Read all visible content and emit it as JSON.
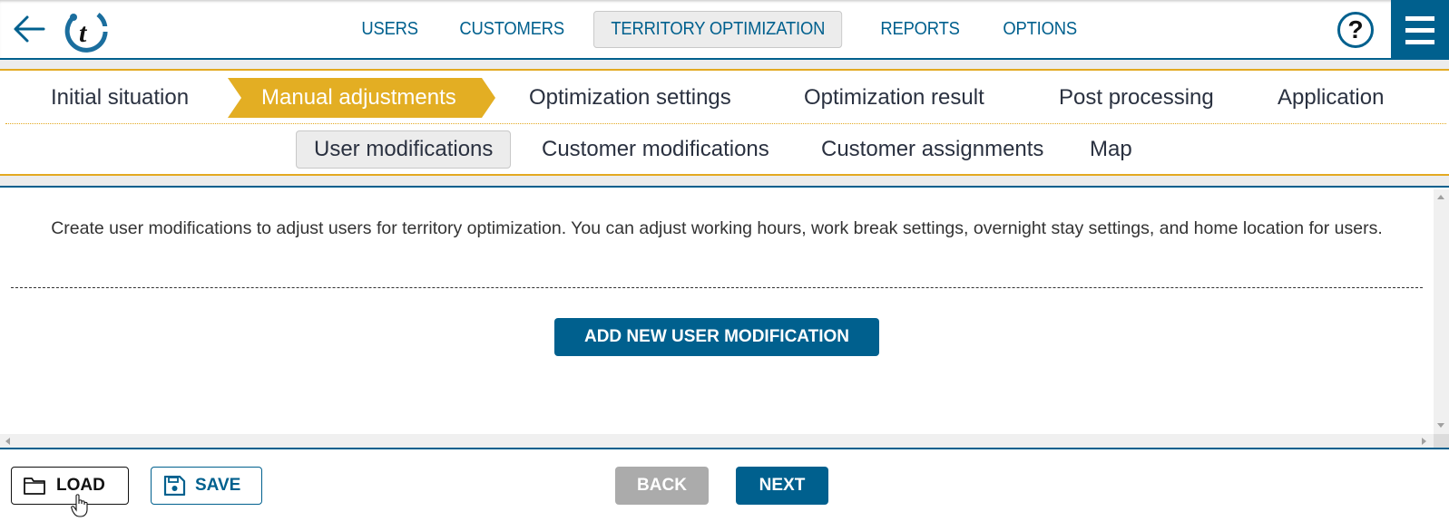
{
  "header": {
    "back_icon": "arrow-left-icon",
    "logo_letter": "t",
    "nav": [
      {
        "label": "USERS",
        "active": false
      },
      {
        "label": "CUSTOMERS",
        "active": false
      },
      {
        "label": "TERRITORY OPTIMIZATION",
        "active": true
      },
      {
        "label": "REPORTS",
        "active": false
      },
      {
        "label": "OPTIONS",
        "active": false
      }
    ],
    "help_label": "?",
    "menu_icon": "hamburger-menu-icon"
  },
  "steps": [
    {
      "label": "Initial situation",
      "active": false
    },
    {
      "label": "Manual adjustments",
      "active": true
    },
    {
      "label": "Optimization settings",
      "active": false
    },
    {
      "label": "Optimization result",
      "active": false
    },
    {
      "label": "Post processing",
      "active": false
    },
    {
      "label": "Application",
      "active": false
    }
  ],
  "subtabs": [
    {
      "label": "User modifications",
      "active": true
    },
    {
      "label": "Customer modifications",
      "active": false
    },
    {
      "label": "Customer assignments",
      "active": false
    },
    {
      "label": "Map",
      "active": false
    }
  ],
  "content": {
    "description": "Create user modifications to adjust users for territory optimization. You can adjust working hours, work break settings, overnight stay settings, and home location for users.",
    "add_button": "ADD NEW USER MODIFICATION"
  },
  "footer": {
    "load_label": "LOAD",
    "save_label": "SAVE",
    "back_label": "BACK",
    "next_label": "NEXT"
  },
  "colors": {
    "primary": "#00608e",
    "accent": "#e3a921",
    "disabled": "#ababab"
  }
}
